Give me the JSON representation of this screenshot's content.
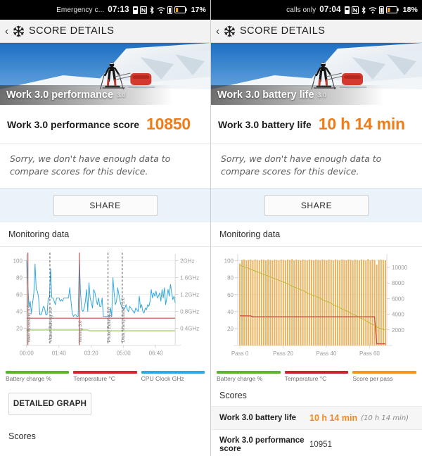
{
  "panels": [
    {
      "id": "performance",
      "status": {
        "carrier": "Emergency c...",
        "time": "07:13",
        "battery": "17%"
      },
      "appbar": {
        "title": "SCORE DETAILS",
        "back_icon": "chevron-left-icon",
        "brand_icon": "snowflake-icon"
      },
      "hero": {
        "title": "Work 3.0 performance",
        "version": "3.0"
      },
      "score": {
        "label": "Work 3.0 performance score",
        "value": "10850"
      },
      "note": "Sorry, we don't have enough data to compare scores for this device.",
      "share_label": "SHARE",
      "monitoring_label": "Monitoring data",
      "legend": [
        {
          "label": "Battery charge %",
          "color": "#5cb531"
        },
        {
          "label": "Temperature °C",
          "color": "#d8252b"
        },
        {
          "label": "CPU Clock GHz",
          "color": "#33a8e0"
        }
      ],
      "detailed_graph_label": "DETAILED GRAPH",
      "scores_label": "Scores"
    },
    {
      "id": "battery",
      "status": {
        "carrier": "calls only",
        "time": "07:04",
        "battery": "18%"
      },
      "appbar": {
        "title": "SCORE DETAILS",
        "back_icon": "chevron-left-icon",
        "brand_icon": "snowflake-icon"
      },
      "hero": {
        "title": "Work 3.0 battery life",
        "version": "3.0"
      },
      "score": {
        "label": "Work 3.0 battery life",
        "value": "10 h 14 min"
      },
      "note": "Sorry, we don't have enough data to compare scores for this device.",
      "share_label": "SHARE",
      "monitoring_label": "Monitoring data",
      "legend": [
        {
          "label": "Battery charge %",
          "color": "#5cb531"
        },
        {
          "label": "Temperature °C",
          "color": "#c8252e"
        },
        {
          "label": "Score per pass",
          "color": "#f09526"
        }
      ],
      "scores_label": "Scores",
      "score_rows": [
        {
          "name": "Work 3.0 battery life",
          "value": "10 h 14 min",
          "sub": "(10 h 14 min)",
          "highlight": true
        },
        {
          "name": "Work 3.0 performance score",
          "value": "10951",
          "sub": "",
          "highlight": false
        }
      ]
    }
  ],
  "colors": {
    "accent_orange": "#f07c18",
    "battery_green": "#5cb531",
    "temperature_red": "#d8252b",
    "cpu_blue": "#33a8e0",
    "score_orange": "#f09526"
  },
  "chart_data": [
    {
      "type": "line",
      "title": "Monitoring data",
      "chart_of": "Work 3.0 performance",
      "xlabel": "",
      "ylabel": "",
      "grid": true,
      "legend_position": "bottom",
      "xticks": [
        "00:00",
        "01:40",
        "03:20",
        "05:00",
        "06:40"
      ],
      "xtick_positions": [
        0,
        100,
        200,
        300,
        400
      ],
      "xlim": [
        0,
        460
      ],
      "left_axis": {
        "ticks": [
          20,
          40,
          60,
          80,
          100
        ],
        "ylim": [
          0,
          108
        ],
        "unit": "%"
      },
      "right_axis": {
        "ticks": [
          "0.4GHz",
          "0.8GHz",
          "1.2GHz",
          "1.6GHz",
          "2GHz"
        ],
        "ylim": [
          0,
          2.16
        ],
        "unit": "GHz"
      },
      "phase_markers": [
        {
          "label": "Web Browsing 3.0",
          "x": 4
        },
        {
          "label": "Video Editing 3.0",
          "x": 72
        },
        {
          "label": "Writing 3.0",
          "x": 163
        },
        {
          "label": "Photo Editing 3.0",
          "x": 252
        },
        {
          "label": "Data Manipulation 3.0",
          "x": 296
        }
      ],
      "series": [
        {
          "name": "CPU Clock GHz",
          "color": "#33a8e0",
          "axis": "right",
          "values": [
            100,
            70,
            46,
            52,
            38,
            50,
            62,
            96,
            66,
            64,
            56,
            36,
            36,
            40,
            46,
            44,
            36,
            36,
            56,
            56,
            90,
            56,
            56,
            52,
            48,
            56,
            56,
            56,
            52,
            54,
            52,
            56,
            56,
            56,
            56,
            56,
            68,
            52,
            38,
            34,
            36,
            36,
            34,
            34,
            100,
            62,
            42,
            40,
            44,
            52,
            66,
            40,
            74,
            56,
            50,
            44,
            66,
            62,
            54,
            48,
            56,
            46,
            46,
            56,
            34,
            34,
            34,
            34,
            34,
            34,
            44,
            34,
            80,
            62,
            48,
            52,
            68,
            60,
            52,
            46,
            44,
            42,
            44,
            48,
            42,
            40,
            46,
            44,
            42,
            40,
            38,
            44,
            42,
            40,
            58,
            44,
            48,
            40,
            38,
            44,
            42,
            48,
            46,
            52,
            66,
            56,
            62,
            58,
            64,
            56,
            58,
            62,
            52,
            66,
            56,
            68,
            48,
            56,
            66,
            58,
            72,
            62,
            54,
            58,
            50
          ]
        },
        {
          "name": "Temperature °C",
          "color": "#c0504d",
          "axis": "left",
          "values": [
            32,
            32,
            32,
            32,
            32,
            32,
            32,
            32,
            32,
            32,
            32,
            32,
            32,
            32,
            32,
            32,
            32,
            32,
            32,
            32,
            32,
            32,
            32,
            32,
            32,
            32,
            32,
            32,
            32,
            32,
            32,
            32,
            32,
            32,
            32,
            32,
            32,
            32,
            32,
            32,
            32,
            32,
            32,
            32,
            32,
            32,
            32,
            32,
            32,
            32,
            32,
            32,
            32,
            32,
            32,
            32,
            32,
            32,
            32,
            32,
            32,
            32,
            32,
            32,
            32,
            32,
            32,
            32,
            32,
            32,
            32,
            32,
            32,
            32,
            32,
            32,
            32,
            32,
            32,
            32,
            32,
            32,
            32,
            32,
            32,
            32,
            32,
            32,
            32,
            32,
            32,
            32,
            32,
            32,
            32,
            32,
            32,
            32,
            32,
            32,
            32,
            32,
            32,
            32,
            32,
            32,
            32,
            32,
            32,
            32,
            32,
            32,
            32,
            32,
            32,
            32,
            32,
            32,
            32,
            32,
            32,
            32,
            32,
            32,
            32
          ]
        },
        {
          "name": "Battery charge %",
          "color": "#8ec64a",
          "axis": "left",
          "values": [
            18,
            18,
            18,
            18,
            18,
            18,
            18,
            18,
            18,
            18,
            18,
            18,
            18,
            18,
            18,
            18,
            18,
            18,
            18,
            18,
            18,
            18,
            18,
            18,
            18,
            18,
            18,
            18,
            18,
            18,
            18,
            18,
            18,
            18,
            18,
            18,
            18,
            18,
            18,
            18,
            18,
            18,
            18,
            18,
            18,
            18,
            18,
            18,
            18,
            18,
            18,
            18,
            17,
            17,
            17,
            17,
            17,
            17,
            17,
            17,
            17,
            17,
            17,
            17,
            17,
            17,
            17,
            17,
            17,
            17,
            17,
            17,
            17,
            17,
            17,
            17,
            17,
            17,
            17,
            17,
            17,
            17,
            17,
            17,
            17,
            17,
            17,
            17,
            17,
            17,
            17,
            17,
            17,
            17,
            17,
            17,
            17,
            17,
            17,
            17,
            17,
            17,
            17,
            17,
            17,
            17,
            17,
            17,
            17,
            17,
            17,
            17,
            17,
            17,
            17,
            17,
            17,
            17,
            17,
            17,
            17,
            17,
            17,
            17,
            17
          ]
        }
      ]
    },
    {
      "type": "bar",
      "title": "Monitoring data",
      "chart_of": "Work 3.0 battery life",
      "xlabel": "",
      "ylabel": "",
      "grid": true,
      "legend_position": "bottom",
      "xticks": [
        "Pass 0",
        "Pass 20",
        "Pass 40",
        "Pass 60"
      ],
      "xtick_positions": [
        0,
        20,
        40,
        60
      ],
      "xlim": [
        -1,
        68
      ],
      "left_axis": {
        "ticks": [
          20,
          40,
          60,
          80,
          100
        ],
        "ylim": [
          0,
          108
        ],
        "unit": "%"
      },
      "right_axis": {
        "ticks": [
          2000,
          4000,
          6000,
          8000,
          10000
        ],
        "ylim": [
          0,
          11700
        ],
        "unit": "score"
      },
      "bars": {
        "name": "Score per pass",
        "color": "#e8a33d",
        "axis": "right",
        "values": [
          10500,
          10950,
          11000,
          10900,
          10950,
          11000,
          10900,
          11000,
          10950,
          10900,
          11000,
          10950,
          10900,
          11000,
          10950,
          10900,
          11000,
          10950,
          10900,
          11000,
          10950,
          10900,
          11000,
          10950,
          11050,
          10900,
          11000,
          10950,
          10900,
          11000,
          10950,
          10900,
          11000,
          10950,
          10900,
          11000,
          10950,
          10900,
          11000,
          10950,
          10900,
          11000,
          10950,
          10900,
          11000,
          10950,
          10900,
          11000,
          10950,
          10900,
          11000,
          10950,
          10900,
          11000,
          10950,
          10900,
          11000,
          10950,
          10900,
          11050,
          10900,
          11000,
          10950,
          10350,
          10950,
          11000,
          10950,
          10900
        ]
      },
      "series": [
        {
          "name": "Battery charge %",
          "color": "#b6bc3c",
          "axis": "left",
          "values": [
            95,
            94,
            93,
            92,
            91,
            90,
            89,
            88,
            87,
            86,
            85,
            84,
            83,
            82,
            81,
            80,
            79,
            78,
            77,
            76,
            75,
            74,
            73,
            72,
            70,
            69,
            68,
            67,
            66,
            65,
            64,
            62,
            61,
            60,
            59,
            58,
            57,
            56,
            54,
            53,
            52,
            51,
            50,
            48,
            47,
            46,
            45,
            43,
            42,
            41,
            40,
            38,
            37,
            36,
            35,
            33,
            32,
            31,
            29,
            28,
            26,
            25,
            24,
            22,
            21,
            20,
            19,
            18
          ]
        },
        {
          "name": "Temperature °C",
          "color": "#c8453a",
          "axis": "left",
          "values": [
            35,
            35,
            35,
            35,
            35,
            35,
            34,
            34,
            34,
            34,
            34,
            34,
            34,
            34,
            34,
            34,
            34,
            34,
            34,
            34,
            34,
            34,
            34,
            34,
            34,
            34,
            34,
            34,
            34,
            34,
            34,
            34,
            34,
            34,
            34,
            34,
            34,
            34,
            34,
            34,
            34,
            34,
            34,
            34,
            34,
            34,
            34,
            34,
            34,
            34,
            34,
            34,
            34,
            34,
            34,
            34,
            34,
            34,
            34,
            34,
            34,
            34,
            34,
            2,
            2,
            2,
            2,
            2
          ]
        }
      ]
    }
  ]
}
